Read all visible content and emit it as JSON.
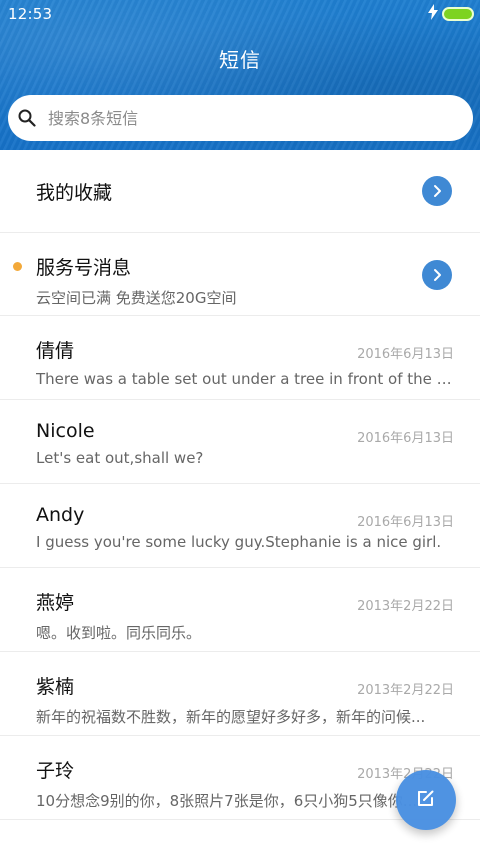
{
  "status_bar": {
    "time": "12:53",
    "battery_color": "#7dd321"
  },
  "header": {
    "title": "短信",
    "bg_color": "#1a78cc"
  },
  "search": {
    "placeholder": "搜索8条短信"
  },
  "items": [
    {
      "kind": "folder",
      "title": "我的收藏",
      "subtitle": ""
    },
    {
      "kind": "folder",
      "title": "服务号消息",
      "subtitle": "云空间已满 免费送您20G空间",
      "unread": true
    },
    {
      "kind": "message",
      "sender": "倩倩",
      "date": "2016年6月13日",
      "preview": "There was a table set out under a tree in front of the ho..."
    },
    {
      "kind": "message",
      "sender": "Nicole",
      "date": "2016年6月13日",
      "preview": "Let's eat out,shall we?"
    },
    {
      "kind": "message",
      "sender": "Andy",
      "date": "2016年6月13日",
      "preview": "I guess you're some lucky guy.Stephanie is a nice girl."
    },
    {
      "kind": "message",
      "sender": "燕婷",
      "date": "2013年2月22日",
      "preview": "嗯。收到啦。同乐同乐。"
    },
    {
      "kind": "message",
      "sender": "紫楠",
      "date": "2013年2月22日",
      "preview": "新年的祝福数不胜数，新年的愿望好多好多，新年的问候..."
    },
    {
      "kind": "message",
      "sender": "子玲",
      "date": "2013年2月22日",
      "preview": "10分想念9别的你，8张照片7张是你，6只小狗5只像你..."
    }
  ],
  "icons": {
    "search": "search-icon",
    "chevron": "chevron-right-icon",
    "compose": "compose-icon",
    "charging": "charging-icon",
    "battery": "battery-icon"
  },
  "colors": {
    "accent": "#3f89d4",
    "fab": "#4a90e2",
    "unread_dot": "#f3a93a"
  }
}
